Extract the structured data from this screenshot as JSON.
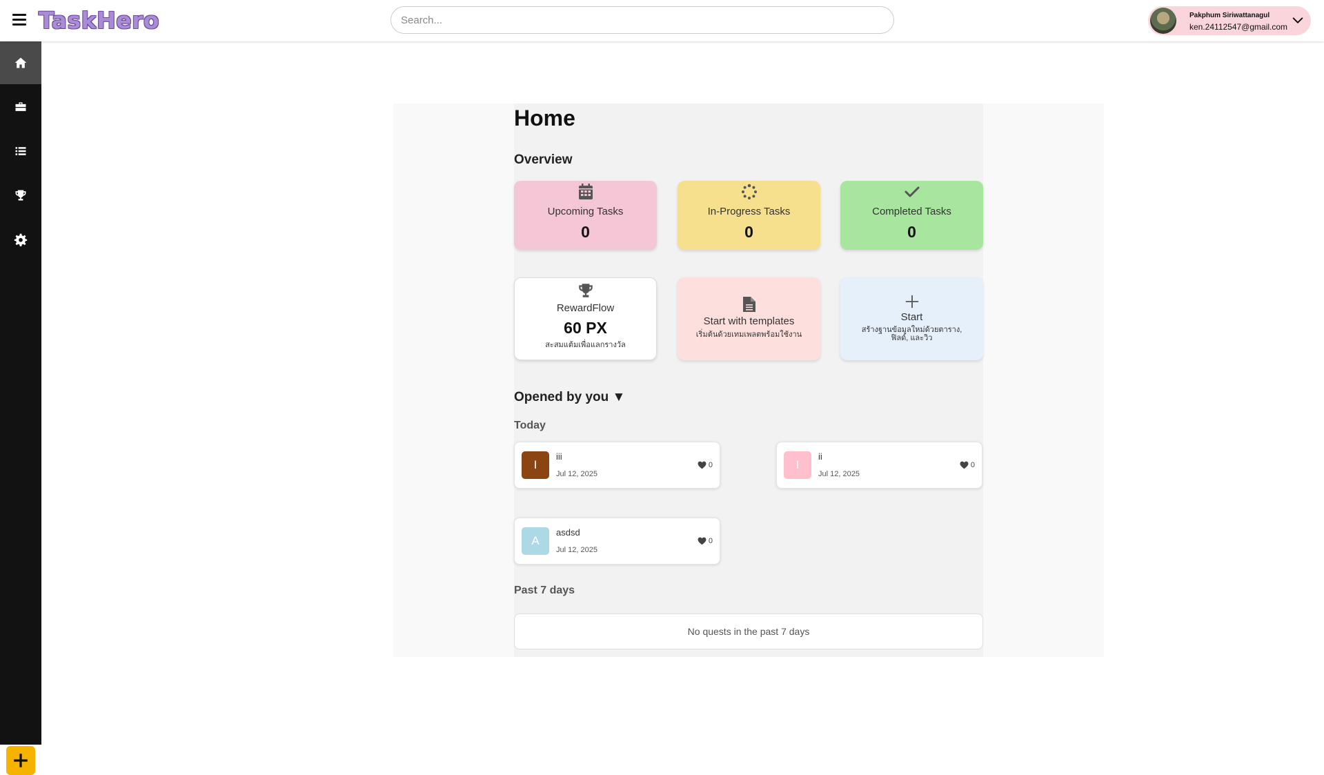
{
  "app": {
    "logo": "TaskHero"
  },
  "header": {
    "search_placeholder": "Search...",
    "user": {
      "name": "Pakphum Siriwattanagul",
      "email": "ken.24112547@gmail.com"
    }
  },
  "sidebar": {
    "items": [
      {
        "icon": "home-icon",
        "active": true
      },
      {
        "icon": "briefcase-icon",
        "active": false
      },
      {
        "icon": "list-icon",
        "active": false
      },
      {
        "icon": "trophy-icon",
        "active": false
      },
      {
        "icon": "gear-icon",
        "active": false
      }
    ],
    "fab_icon": "plus-icon"
  },
  "main": {
    "title": "Home",
    "overview_label": "Overview",
    "stats": [
      {
        "label": "Upcoming Tasks",
        "count": "0",
        "color": "#f5c6d6",
        "icon": "calendar-icon"
      },
      {
        "label": "In-Progress Tasks",
        "count": "0",
        "color": "#f6e08e",
        "icon": "spinner-icon"
      },
      {
        "label": "Completed Tasks",
        "count": "0",
        "color": "#a8e6a0",
        "icon": "check-icon"
      }
    ],
    "actions": {
      "reward": {
        "title": "RewardFlow",
        "value": "60 PX",
        "sub": "สะสมแต้มเพื่อแลกรางวัล",
        "icon": "trophy-icon",
        "color": "#ffffff"
      },
      "templates": {
        "title": "Start with templates",
        "sub": "เริ่มต้นด้วยเทมเพลตพร้อมใช้งาน",
        "icon": "document-icon",
        "color": "#fde0de"
      },
      "start": {
        "title": "Start",
        "sub": "สร้างฐานข้อมูลใหม่ด้วยตาราง, ฟิลด์, และวิว",
        "icon": "plus-icon",
        "color": "#e6f0fb"
      }
    },
    "opened_label": "Opened by you ▼",
    "today_label": "Today",
    "quests": [
      {
        "letter": "I",
        "name": "iii",
        "date": "Jul 12, 2025",
        "likes": "0",
        "color": "#8b4513"
      },
      {
        "letter": "I",
        "name": "ii",
        "date": "Jul 12, 2025",
        "likes": "0",
        "color": "#ffc0cb"
      },
      {
        "letter": "A",
        "name": "asdsd",
        "date": "Jul 12, 2025",
        "likes": "0",
        "color": "#add8e6"
      }
    ],
    "past_label": "Past 7 days",
    "past_empty": "No quests in the past 7 days"
  }
}
